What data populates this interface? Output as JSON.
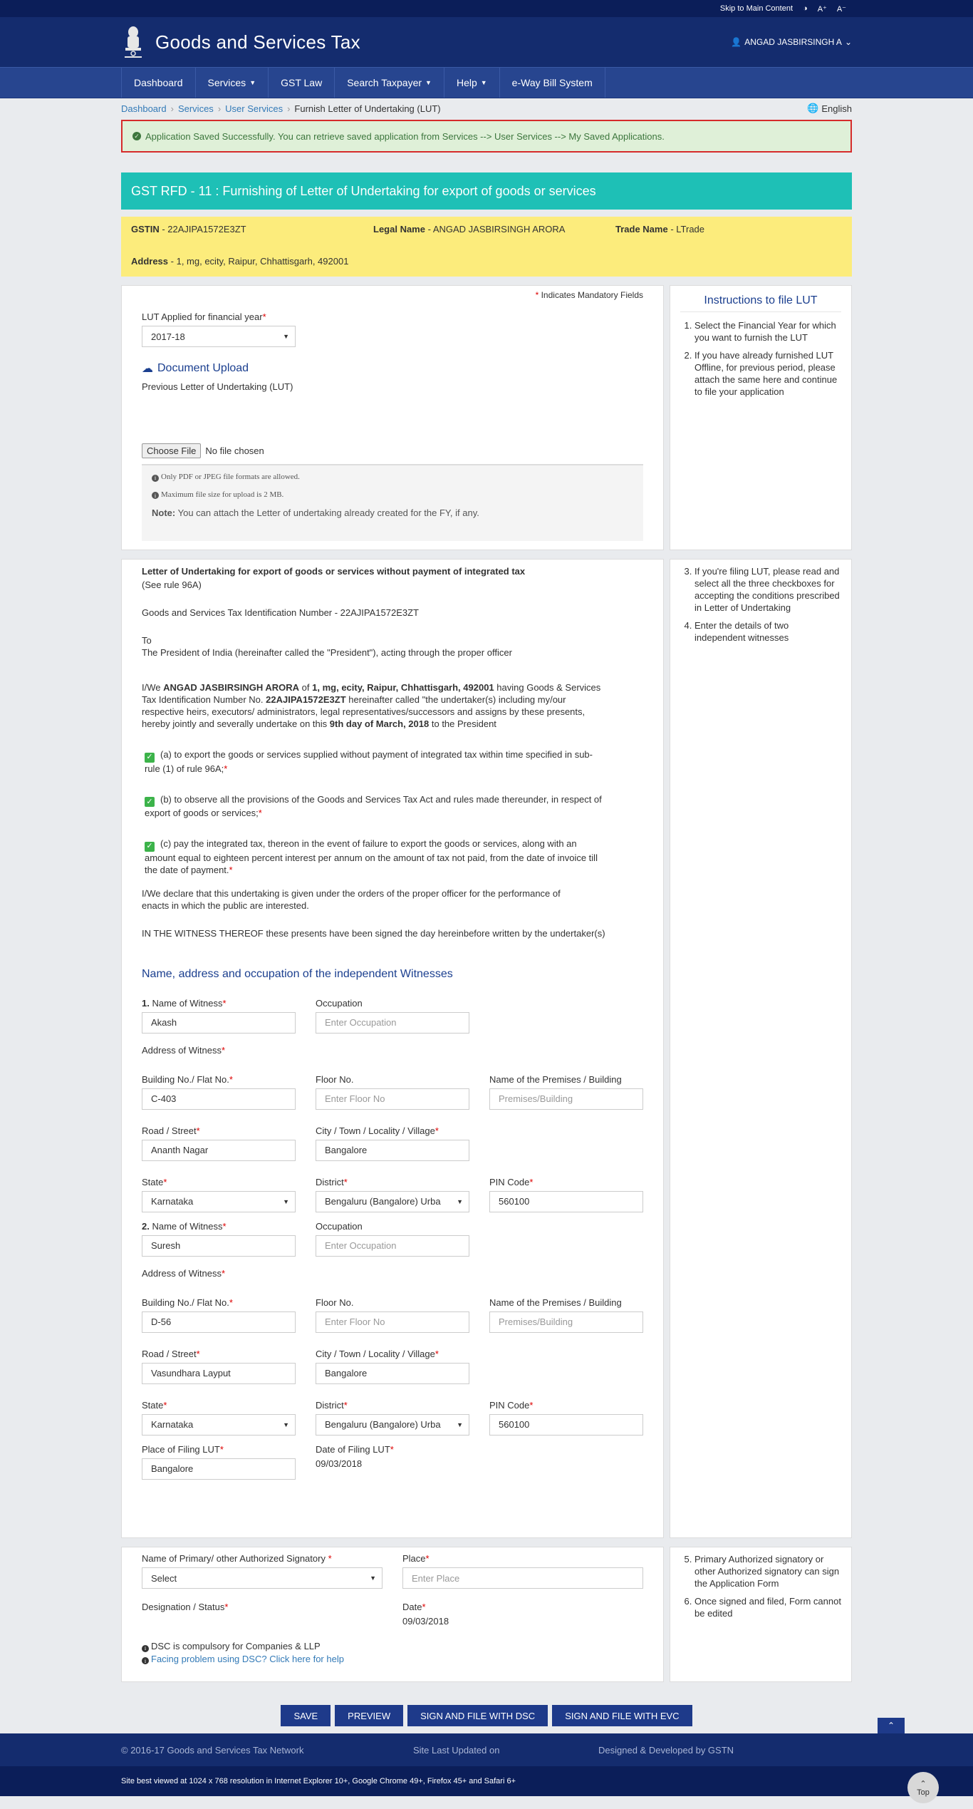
{
  "topbar": {
    "skip": "Skip to Main Content",
    "contrast": "◑",
    "font_up": "A⁺",
    "font_down": "A⁻"
  },
  "header": {
    "title": "Goods and Services Tax",
    "user": "ANGAD JASBIRSINGH A"
  },
  "nav": [
    "Dashboard",
    "Services",
    "GST Law",
    "Search Taxpayer",
    "Help",
    "e-Way Bill System"
  ],
  "breadcrumb": {
    "items": [
      "Dashboard",
      "Services",
      "User Services"
    ],
    "current": "Furnish Letter of Undertaking (LUT)",
    "language": "English"
  },
  "alert": "Application Saved Successfully. You can retrieve saved application from Services --> User Services --> My Saved Applications.",
  "form_title": "GST RFD - 11 : Furnishing of Letter of Undertaking for export of goods or services",
  "taxpayer": {
    "gstin_label": "GSTIN",
    "gstin": "22AJIPA1572E3ZT",
    "legal_label": "Legal Name",
    "legal_name": "ANGAD JASBIRSINGH ARORA",
    "trade_label": "Trade Name",
    "trade_name": "LTrade",
    "address_label": "Address",
    "address": "1, mg, ecity, Raipur, Chhattisgarh, 492001"
  },
  "section1": {
    "mandatory_note": "Indicates Mandatory Fields",
    "fy_label": "LUT Applied for financial year",
    "fy_value": "2017-18",
    "doc_upload": "Document Upload",
    "prev_lut": "Previous Letter of Undertaking (LUT)",
    "choose_file": "Choose File",
    "no_file": "No file chosen",
    "note1": "Only PDF or JPEG file formats are allowed.",
    "note2": "Maximum file size for upload is 2 MB.",
    "note_label": "Note:",
    "note3": "You can attach the Letter of undertaking already created for the FY, if any."
  },
  "instructions": {
    "title": "Instructions to file LUT",
    "items": [
      "Select the Financial Year for which you want to furnish the LUT",
      "If you have already furnished LUT Offline, for previous period, please attach the same here and continue to file your application",
      "If you're filing LUT, please read and select all the three checkboxes for accepting the conditions prescribed in Letter of Undertaking",
      "Enter the details of two independent witnesses",
      "Primary Authorized signatory or other Authorized signatory can sign the Application Form",
      "Once signed and filed, Form cannot be edited"
    ]
  },
  "lut": {
    "heading": "Letter of Undertaking for export of goods or services without payment of integrated tax",
    "rule": "(See rule 96A)",
    "gstin_line": "Goods and Services Tax Identification Number - 22AJIPA1572E3ZT",
    "to": "To",
    "president": "The President of India (hereinafter called the \"President\"), acting through the proper officer",
    "p1_a": "I/We",
    "p1_name": "ANGAD JASBIRSINGH ARORA",
    "p1_b": "of",
    "p1_addr": "1, mg, ecity, Raipur, Chhattisgarh, 492001",
    "p1_c": "having Goods & Services Tax Identification Number No.",
    "p1_gstin": "22AJIPA1572E3ZT",
    "p1_d": "hereinafter called \"the undertaker(s) including my/our respective heirs, executors/ administrators, legal representatives/successors and assigns by these presents, hereby jointly and severally undertake on this",
    "p1_date": "9th day of March, 2018",
    "p1_e": "to the President",
    "cond_a": "(a) to export the goods or services supplied without payment of integrated tax within time specified in sub-rule (1) of rule 96A;",
    "cond_b": "(b) to observe all the provisions of the Goods and Services Tax Act and rules made thereunder, in respect of export of goods or services;",
    "cond_c": "(c) pay the integrated tax, thereon in the event of failure to export the goods or services, along with an amount equal to eighteen percent interest per annum on the amount of tax not paid, from the date of invoice till the date of payment.",
    "declare": "I/We declare that this undertaking is given under the orders of the proper officer for the performance of enacts in which the public are interested.",
    "witness_clause": "IN THE WITNESS THEREOF these presents have been signed the day hereinbefore written by the undertaker(s)"
  },
  "witness_labels": {
    "title": "Name, address and occupation of the independent Witnesses",
    "name": "Name of Witness",
    "occupation": "Occupation",
    "occupation_ph": "Enter Occupation",
    "address": "Address of Witness",
    "building": "Building No./ Flat No.",
    "floor": "Floor No.",
    "floor_ph": "Enter Floor No",
    "premises": "Name of the Premises / Building",
    "premises_ph": "Premises/Building",
    "road": "Road / Street",
    "city": "City / Town / Locality / Village",
    "state": "State",
    "district": "District",
    "pin": "PIN Code"
  },
  "witnesses": [
    {
      "num": "1.",
      "name": "Akash",
      "building": "C-403",
      "road": "Ananth Nagar",
      "city": "Bangalore",
      "state": "Karnataka",
      "district": "Bengaluru (Bangalore) Urba",
      "pin": "560100"
    },
    {
      "num": "2.",
      "name": "Suresh",
      "building": "D-56",
      "road": "Vasundhara Layput",
      "city": "Bangalore",
      "state": "Karnataka",
      "district": "Bengaluru (Bangalore) Urba",
      "pin": "560100"
    }
  ],
  "filing": {
    "place_label": "Place of Filing LUT",
    "place": "Bangalore",
    "date_label": "Date of Filing LUT",
    "date": "09/03/2018"
  },
  "signatory": {
    "name_label": "Name of Primary/ other Authorized Signatory",
    "name_value": "Select",
    "place_label": "Place",
    "place_ph": "Enter Place",
    "designation_label": "Designation / Status",
    "date_label": "Date",
    "date": "09/03/2018",
    "dsc_note": "DSC is compulsory for Companies & LLP",
    "dsc_help": "Facing problem using DSC? Click here for help"
  },
  "buttons": {
    "save": "SAVE",
    "preview": "PREVIEW",
    "dsc": "SIGN AND FILE WITH DSC",
    "evc": "SIGN AND FILE WITH EVC"
  },
  "footer": {
    "copyright": "© 2016-17 Goods and Services Tax Network",
    "updated": "Site Last Updated on",
    "designed": "Designed & Developed by GSTN",
    "bestview": "Site best viewed at 1024 x 768 resolution in Internet Explorer 10+, Google Chrome 49+, Firefox 45+ and Safari 6+",
    "top": "Top"
  },
  "colors": {
    "header": "#142c6e",
    "nav": "#27458f",
    "teal": "#1ec0b6",
    "band": "#fcec7c",
    "button": "#1e3a8a"
  }
}
